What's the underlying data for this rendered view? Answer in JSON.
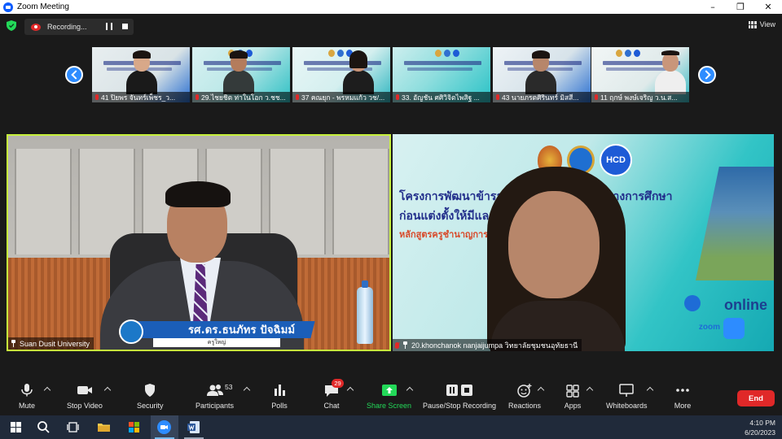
{
  "window": {
    "title": "Zoom Meeting",
    "controls": [
      "–",
      "❐",
      "✕"
    ]
  },
  "recording": {
    "label": "Recording..."
  },
  "view": {
    "label": "View"
  },
  "gallery": [
    {
      "name": "41 ปิยพร จันทร์เพ็ชร_ว..."
    },
    {
      "name": "29.ไชยชิต ท่าในโอก ว.ชช..."
    },
    {
      "name": "37 คณยุก - พรหมแก้ว วช/..."
    },
    {
      "name": "33. อัญชัน ศศิวิจิตไพสิฐ ..."
    },
    {
      "name": "43 นายภรตศิรินทร์ มิสสี..."
    },
    {
      "name": "11 ฤกษ์ พงษ์เจริญ ว.น.ส..."
    }
  ],
  "tiles": {
    "left": {
      "participant": "Suan Dusit University",
      "lower_third_title": "รศ.ดร.ธนภัทร ปัจฉิมม์",
      "lower_third_sub": "ครูใหญ่"
    },
    "right": {
      "participant": "20.khonchanok nanjaijumpa วิทยาลัยชุมชนอุทัยธานี",
      "slide_line1": "โครงการพัฒนาข้าราชการครูและบุคลากรทางการศึกษา",
      "slide_line2": "ก่อนแต่งตั้งให้มีและเลื่อนวิทยฐานะ",
      "slide_line3": "หลักสูตรครูชำนาญการ",
      "logo_hcd": "HCD",
      "online_label": "online",
      "zoom_label": "zoom"
    }
  },
  "toolbar": {
    "mute": "Mute",
    "stop_video": "Stop Video",
    "security": "Security",
    "participants": "Participants",
    "participants_count": "53",
    "polls": "Polls",
    "chat": "Chat",
    "chat_badge": "29",
    "share_screen": "Share Screen",
    "pause_recording": "Pause/Stop Recording",
    "reactions": "Reactions",
    "apps": "Apps",
    "whiteboards": "Whiteboards",
    "more": "More",
    "end": "End"
  },
  "taskbar": {
    "time": "4:10 PM",
    "date": "6/20/2023"
  },
  "colors": {
    "zoom_blue": "#2d8cff",
    "end_red": "#e02828",
    "share_green": "#23d959",
    "active_speaker": "#c7f13c"
  }
}
